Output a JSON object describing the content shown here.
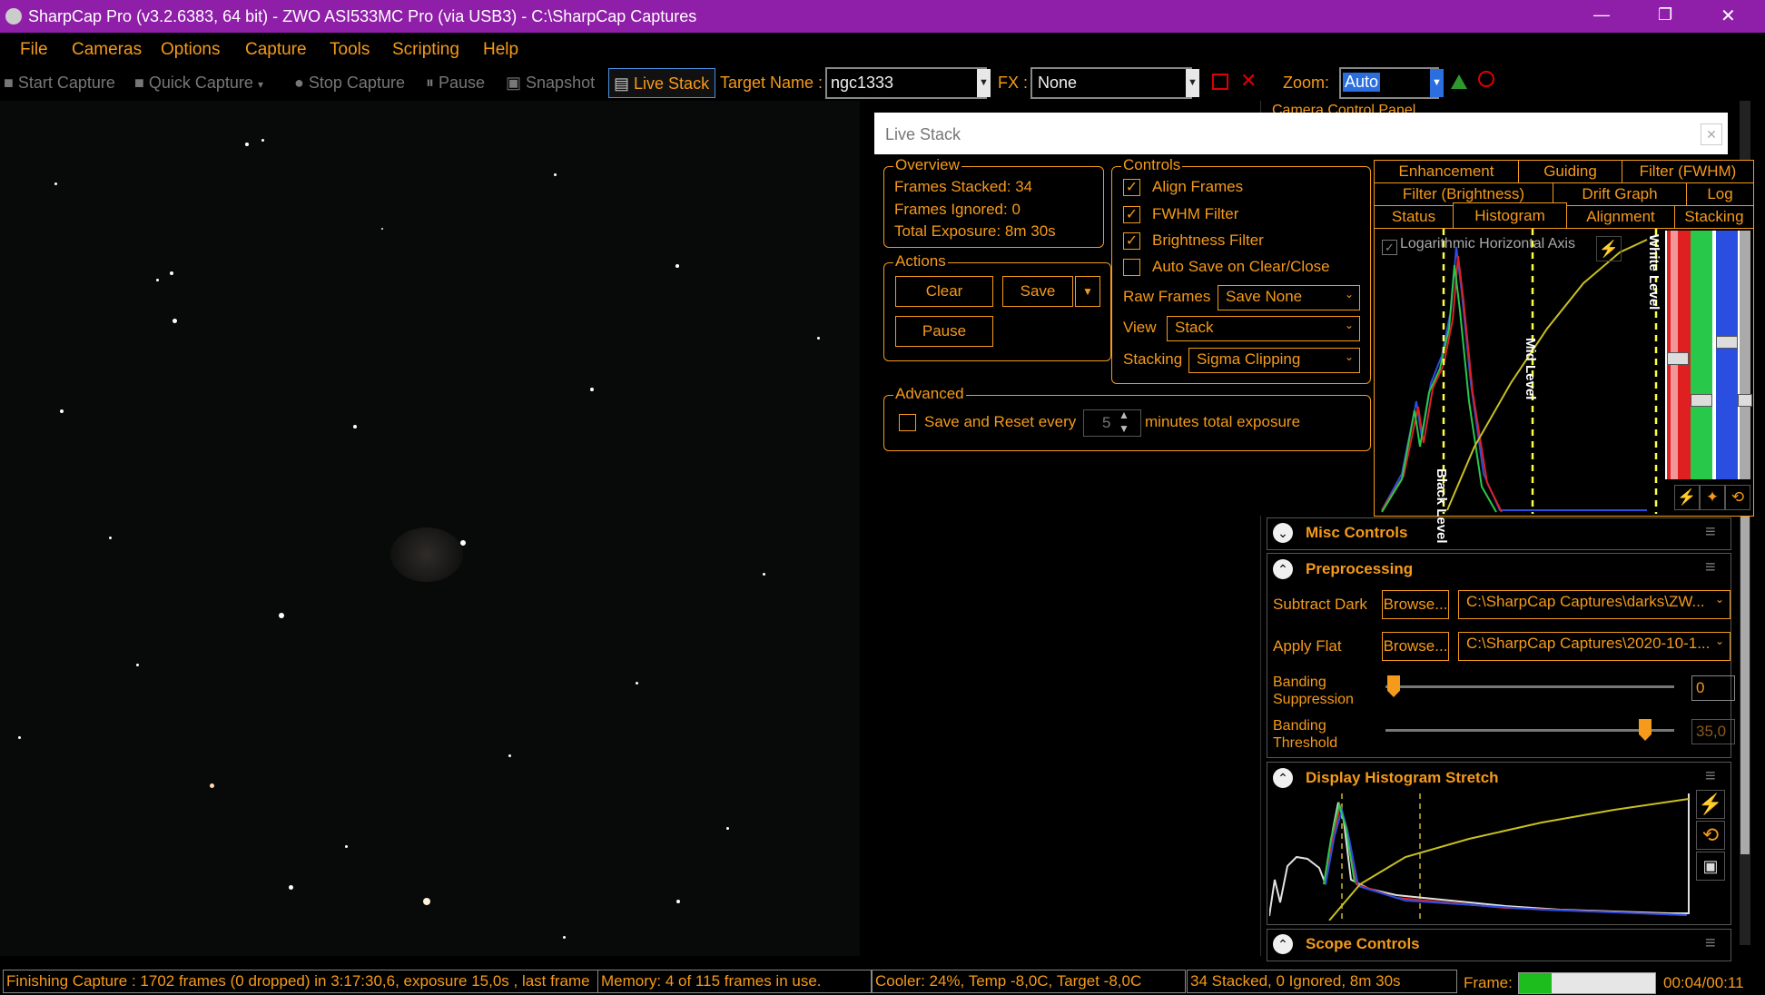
{
  "titlebar": {
    "title": "SharpCap Pro (v3.2.6383, 64 bit) - ZWO ASI533MC Pro (via USB3) - C:\\SharpCap Captures",
    "minimize": "—",
    "restore": "❐",
    "close": "✕"
  },
  "menu": [
    "File",
    "Cameras",
    "Options",
    "Capture",
    "Tools",
    "Scripting",
    "Help"
  ],
  "toolbar": {
    "start_capture": "Start Capture",
    "quick_capture": "Quick Capture",
    "stop_capture": "Stop Capture",
    "pause": "Pause",
    "snapshot": "Snapshot",
    "live_stack": "Live Stack",
    "target_label": "Target Name :",
    "target_value": "ngc1333",
    "fx_label": "FX :",
    "fx_value": "None",
    "zoom_label": "Zoom:",
    "zoom_value": "Auto"
  },
  "livestack": {
    "title": "Live Stack",
    "overview": {
      "label": "Overview",
      "frames_stacked": "Frames Stacked: 34",
      "frames_ignored": "Frames Ignored:  0",
      "total_exposure": "Total Exposure:    8m 30s"
    },
    "actions": {
      "label": "Actions",
      "clear": "Clear",
      "save": "Save",
      "pause": "Pause"
    },
    "controls": {
      "label": "Controls",
      "align": "Align Frames",
      "fwhm": "FWHM Filter",
      "brightness": "Brightness Filter",
      "autosave": "Auto Save on Clear/Close",
      "raw_label": "Raw Frames",
      "raw_value": "Save None",
      "view_label": "View",
      "view_value": "Stack",
      "stacking_label": "Stacking",
      "stacking_value": "Sigma Clipping"
    },
    "advanced": {
      "label": "Advanced",
      "save_reset": "Save and Reset every",
      "minutes": "5",
      "suffix": "minutes total exposure"
    },
    "tabs_row1": [
      "Enhancement",
      "Guiding",
      "Filter (FWHM)"
    ],
    "tabs_row2": [
      "Filter (Brightness)",
      "Drift Graph",
      "Log"
    ],
    "tabs_row3": [
      "Status",
      "Histogram",
      "Alignment",
      "Stacking"
    ],
    "hist": {
      "log_axis": "Logarithmic Horizontal Axis",
      "black": "Black Level",
      "mid": "Mid Level",
      "white": "White Level"
    }
  },
  "right": {
    "camera_panel": "Camera Control Panel",
    "misc": "Misc Controls",
    "pre": "Preprocessing",
    "subtract_dark": "Subtract Dark",
    "browse": "Browse...",
    "dark_path": "C:\\SharpCap Captures\\darks\\ZW...",
    "apply_flat": "Apply Flat",
    "flat_path": "C:\\SharpCap Captures\\2020-10-1...",
    "banding_supp": "Banding\nSuppression",
    "banding_supp_value": "0",
    "banding_thr": "Banding\nThreshold",
    "banding_thr_value": "35,0",
    "display_hist": "Display Histogram Stretch",
    "scope": "Scope Controls"
  },
  "status": {
    "capture": "Finishing Capture : 1702 frames (0 dropped) in 3:17:30,6, exposure 15,0s , last frame",
    "memory": "Memory: 4 of 115 frames in use.",
    "cooler": "Cooler: 24%, Temp -8,0C, Target -8,0C",
    "stacked": "34 Stacked, 0 Ignored, 8m 30s",
    "frame_label": "Frame:",
    "time": "00:04/00:11"
  },
  "colors": {
    "accent": "#f59a1a",
    "title_bg": "#8f1ea8"
  }
}
